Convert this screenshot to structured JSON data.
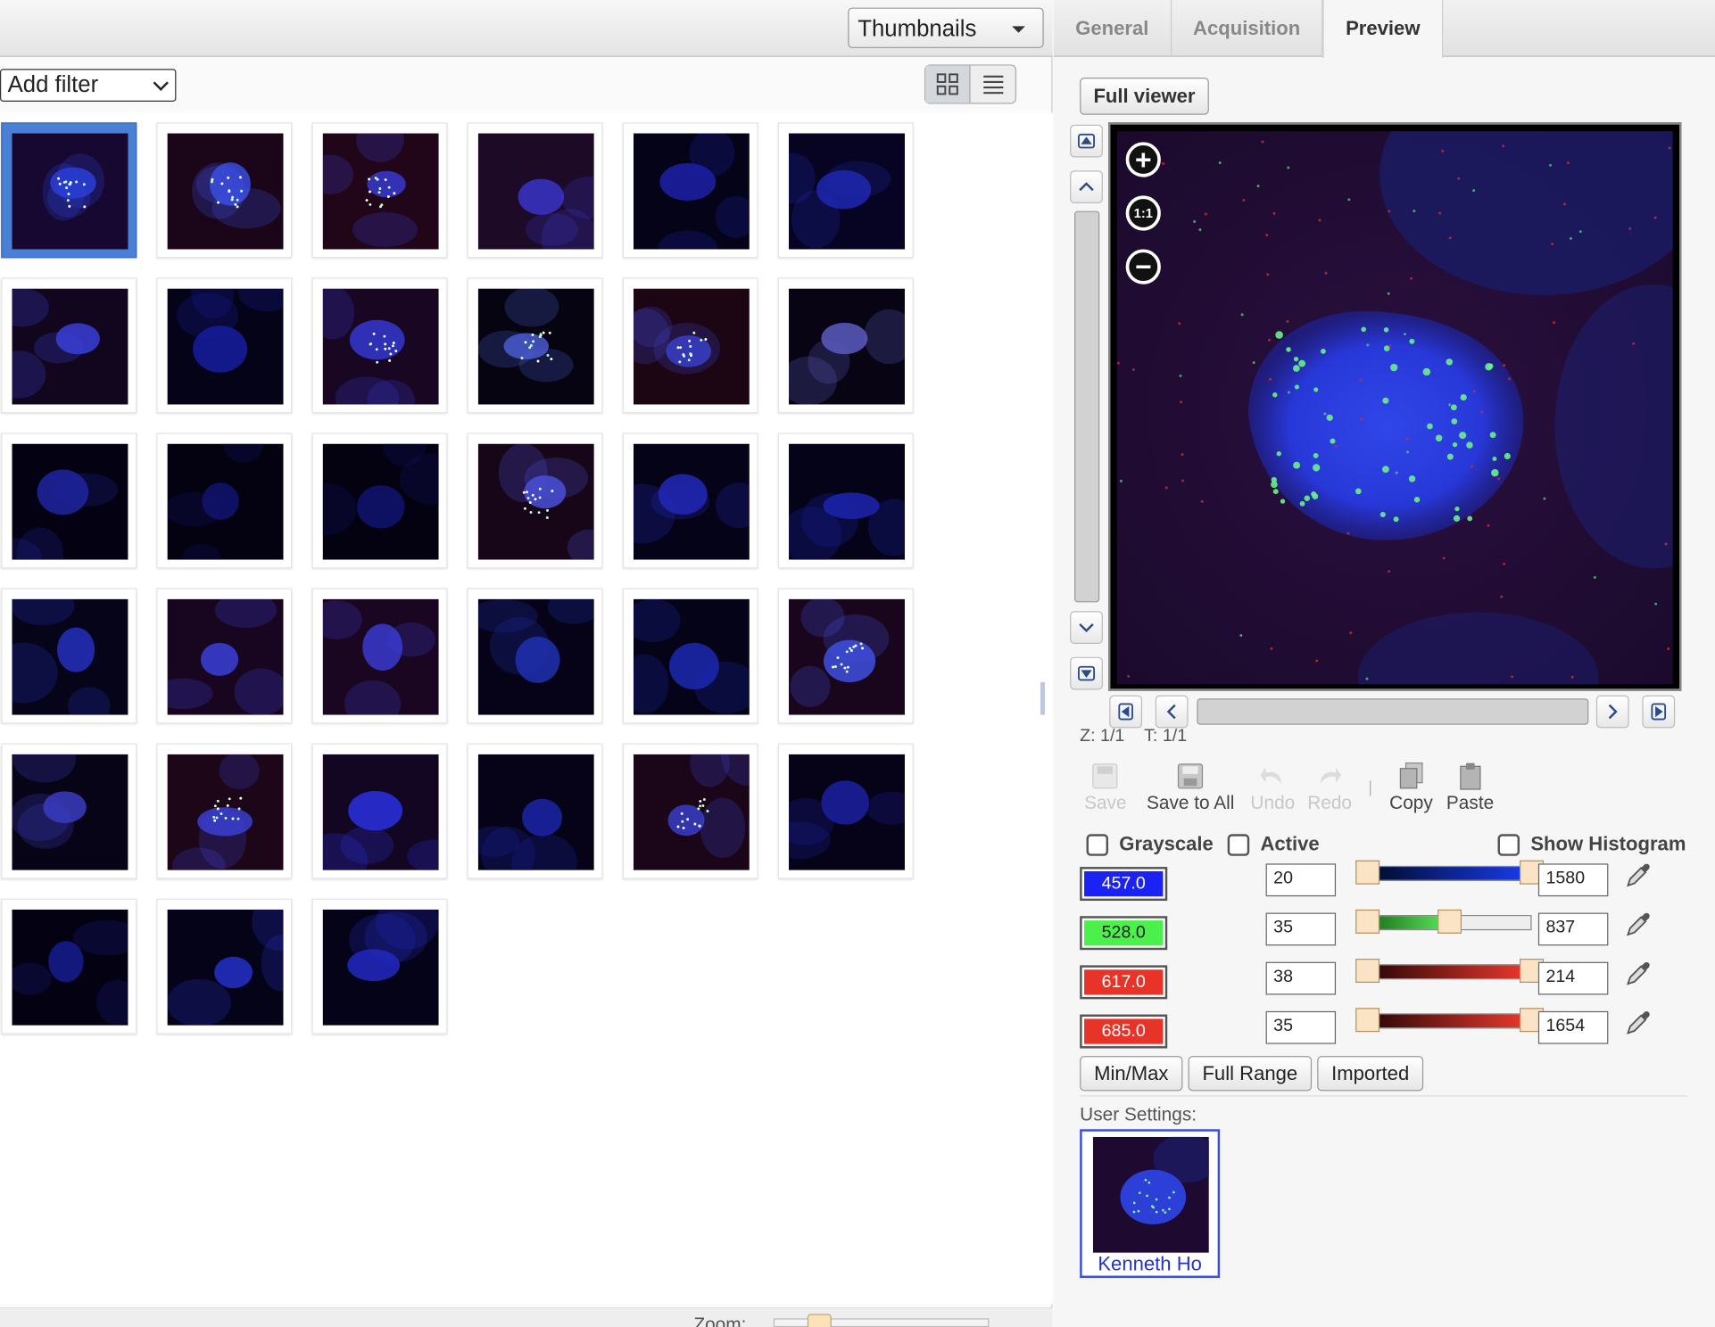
{
  "left_panel": {
    "view_select": "Thumbnails",
    "filter_select": "Add filter",
    "zoom_label": "Zoom:",
    "thumbnails": [
      {
        "bg": "#160830",
        "cell": "#2a3ed8",
        "dots": true,
        "selected": true
      },
      {
        "bg": "#1a0618",
        "cell": "#3a4de0",
        "dots": true
      },
      {
        "bg": "#200618",
        "cell": "#3a3ad0",
        "dots": true
      },
      {
        "bg": "#1c0a26",
        "cell": "#3a34c8",
        "dots": false
      },
      {
        "bg": "#050318",
        "cell": "#1c20a8",
        "dots": false
      },
      {
        "bg": "#060422",
        "cell": "#1e28b0",
        "dots": false
      },
      {
        "bg": "#12061e",
        "cell": "#3a3ed8",
        "dots": false
      },
      {
        "bg": "#050318",
        "cell": "#161ca0",
        "dots": false
      },
      {
        "bg": "#180622",
        "cell": "#3438d0",
        "dots": true
      },
      {
        "bg": "#050410",
        "cell": "#4a5ad0",
        "dots": true
      },
      {
        "bg": "#1c0614",
        "cell": "#3a3ec8",
        "dots": true
      },
      {
        "bg": "#080414",
        "cell": "#5a5cc0",
        "dots": false
      },
      {
        "bg": "#040212",
        "cell": "#1e24a0",
        "dots": false
      },
      {
        "bg": "#040210",
        "cell": "#101470",
        "dots": false
      },
      {
        "bg": "#040210",
        "cell": "#101470",
        "dots": false
      },
      {
        "bg": "#160618",
        "cell": "#4a50d8",
        "dots": true
      },
      {
        "bg": "#050318",
        "cell": "#2228b8",
        "dots": false
      },
      {
        "bg": "#050318",
        "cell": "#1c24b0",
        "dots": false
      },
      {
        "bg": "#060418",
        "cell": "#2430c0",
        "dots": false
      },
      {
        "bg": "#180620",
        "cell": "#3a40d8",
        "dots": false
      },
      {
        "bg": "#1a0620",
        "cell": "#3a3ad0",
        "dots": false
      },
      {
        "bg": "#060318",
        "cell": "#2030b0",
        "dots": false
      },
      {
        "bg": "#050318",
        "cell": "#1c28b0",
        "dots": false
      },
      {
        "bg": "#1a061c",
        "cell": "#4050e0",
        "dots": true
      },
      {
        "bg": "#080418",
        "cell": "#3a3cc0",
        "dots": false
      },
      {
        "bg": "#1c0618",
        "cell": "#3a40d0",
        "dots": true
      },
      {
        "bg": "#120622",
        "cell": "#2a30e0",
        "dots": false
      },
      {
        "bg": "#060318",
        "cell": "#1c24a8",
        "dots": false
      },
      {
        "bg": "#1a0618",
        "cell": "#3a3ec8",
        "dots": true
      },
      {
        "bg": "#060318",
        "cell": "#1c20a0",
        "dots": false
      },
      {
        "bg": "#040212",
        "cell": "#161c90",
        "dots": false
      },
      {
        "bg": "#050318",
        "cell": "#2430c8",
        "dots": false
      },
      {
        "bg": "#050318",
        "cell": "#2228c0",
        "dots": false
      }
    ]
  },
  "right_panel": {
    "tabs": [
      {
        "label": "General",
        "active": false
      },
      {
        "label": "Acquisition",
        "active": false
      },
      {
        "label": "Preview",
        "active": true
      }
    ],
    "full_viewer": "Full viewer",
    "zoom_in_icon": "+",
    "zoom_reset_icon": "1:1",
    "zoom_out_icon": "−",
    "z_label": "Z: 1/1",
    "t_label": "T: 1/1",
    "tools": {
      "save": "Save",
      "save_to_all": "Save to All",
      "undo": "Undo",
      "redo": "Redo",
      "copy": "Copy",
      "paste": "Paste"
    },
    "checkboxes": {
      "grayscale": "Grayscale",
      "active": "Active",
      "show_histogram": "Show Histogram"
    },
    "channels": [
      {
        "label": "457.0",
        "color": "#1a23f4",
        "min": "20",
        "max": "1580",
        "slider_from": "#000a2a",
        "slider_to": "#1a3cf0",
        "handle_lo": 0.0,
        "handle_hi": 1.0
      },
      {
        "label": "528.0",
        "color": "#4cf04c",
        "min": "35",
        "max": "837",
        "slider_from": "#1a6e1a",
        "slider_to": "#5ee85e",
        "handle_lo": 0.0,
        "handle_hi": 0.5
      },
      {
        "label": "617.0",
        "color": "#e83428",
        "min": "38",
        "max": "214",
        "slider_from": "#2a0606",
        "slider_to": "#ee3a2e",
        "handle_lo": 0.0,
        "handle_hi": 1.0
      },
      {
        "label": "685.0",
        "color": "#e83428",
        "min": "35",
        "max": "1654",
        "slider_from": "#2a0606",
        "slider_to": "#ee3a2e",
        "handle_lo": 0.0,
        "handle_hi": 1.0
      }
    ],
    "buttons": {
      "minmax": "Min/Max",
      "full_range": "Full Range",
      "imported": "Imported"
    },
    "user_settings_label": "User Settings:",
    "user_name": "Kenneth Ho"
  }
}
